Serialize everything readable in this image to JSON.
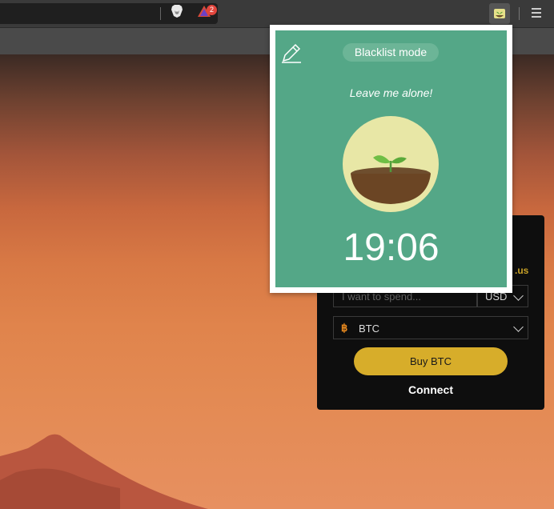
{
  "toolbar": {
    "rewards_badge": "2"
  },
  "widget": {
    "domain_suffix": ".us",
    "spend_placeholder": "I want to spend...",
    "currency": "USD",
    "coin_symbol": "฿",
    "coin": "BTC",
    "buy_label": "Buy BTC",
    "connect_label": "Connect"
  },
  "popup": {
    "mode_label": "Blacklist mode",
    "message": "Leave me alone!",
    "timer": "19:06"
  },
  "colors": {
    "popup_bg": "#54a787",
    "tree_circle": "#e8e7a6",
    "buy_button": "#d7ad2a"
  },
  "icons": [
    "brave-lion-icon",
    "rewards-triangle-icon",
    "forest-extension-icon",
    "hamburger-menu-icon",
    "pencil-edit-icon",
    "bitcoin-icon",
    "chevron-down-icon",
    "sapling-icon"
  ]
}
